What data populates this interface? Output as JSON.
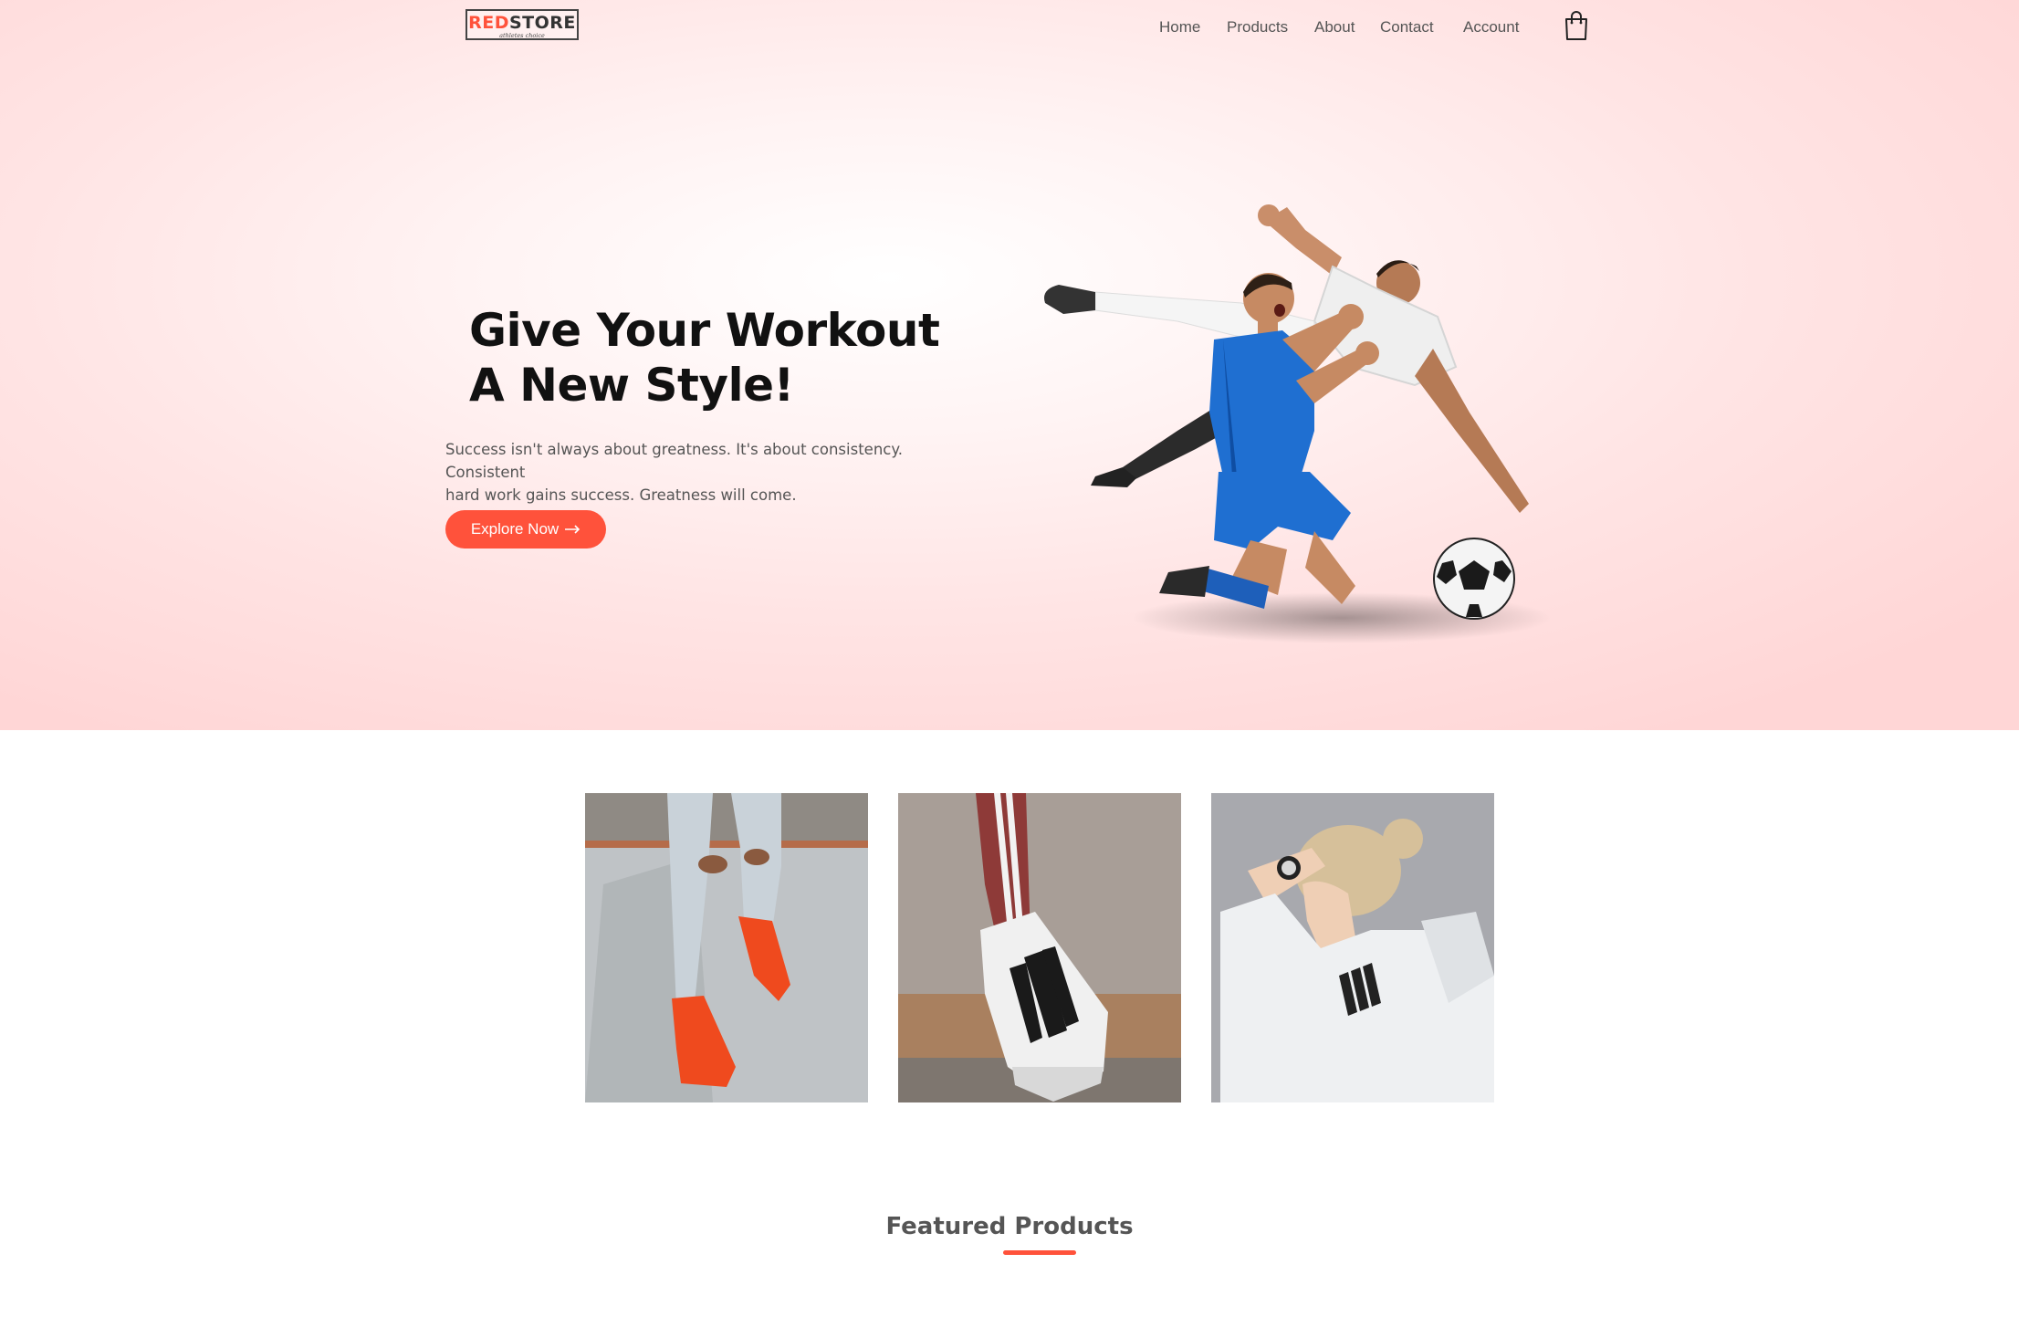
{
  "brand": {
    "name_red": "RED",
    "name_dark": "STORE",
    "tagline": "athletes choice"
  },
  "nav": {
    "items": [
      {
        "label": "Home"
      },
      {
        "label": "Products"
      },
      {
        "label": "About"
      },
      {
        "label": "Contact"
      },
      {
        "label": "Account"
      }
    ],
    "cart_icon": "shopping-bag-icon"
  },
  "hero": {
    "title_line1": "Give Your Workout",
    "title_line2": "A New Style!",
    "text_line1": "Success isn't always about greatness. It's about consistency. Consistent",
    "text_line2": "hard work gains success. Greatness will come.",
    "button_label": "Explore Now",
    "button_icon": "arrow-right-icon"
  },
  "categories": [
    {
      "name": "category-sneakers"
    },
    {
      "name": "category-shoes"
    },
    {
      "name": "category-hoodie"
    }
  ],
  "featured": {
    "title": "Featured Products"
  },
  "colors": {
    "accent": "#ff523b",
    "hero_bg": "#ffd6d6",
    "text": "#555555",
    "heading": "#111111"
  }
}
